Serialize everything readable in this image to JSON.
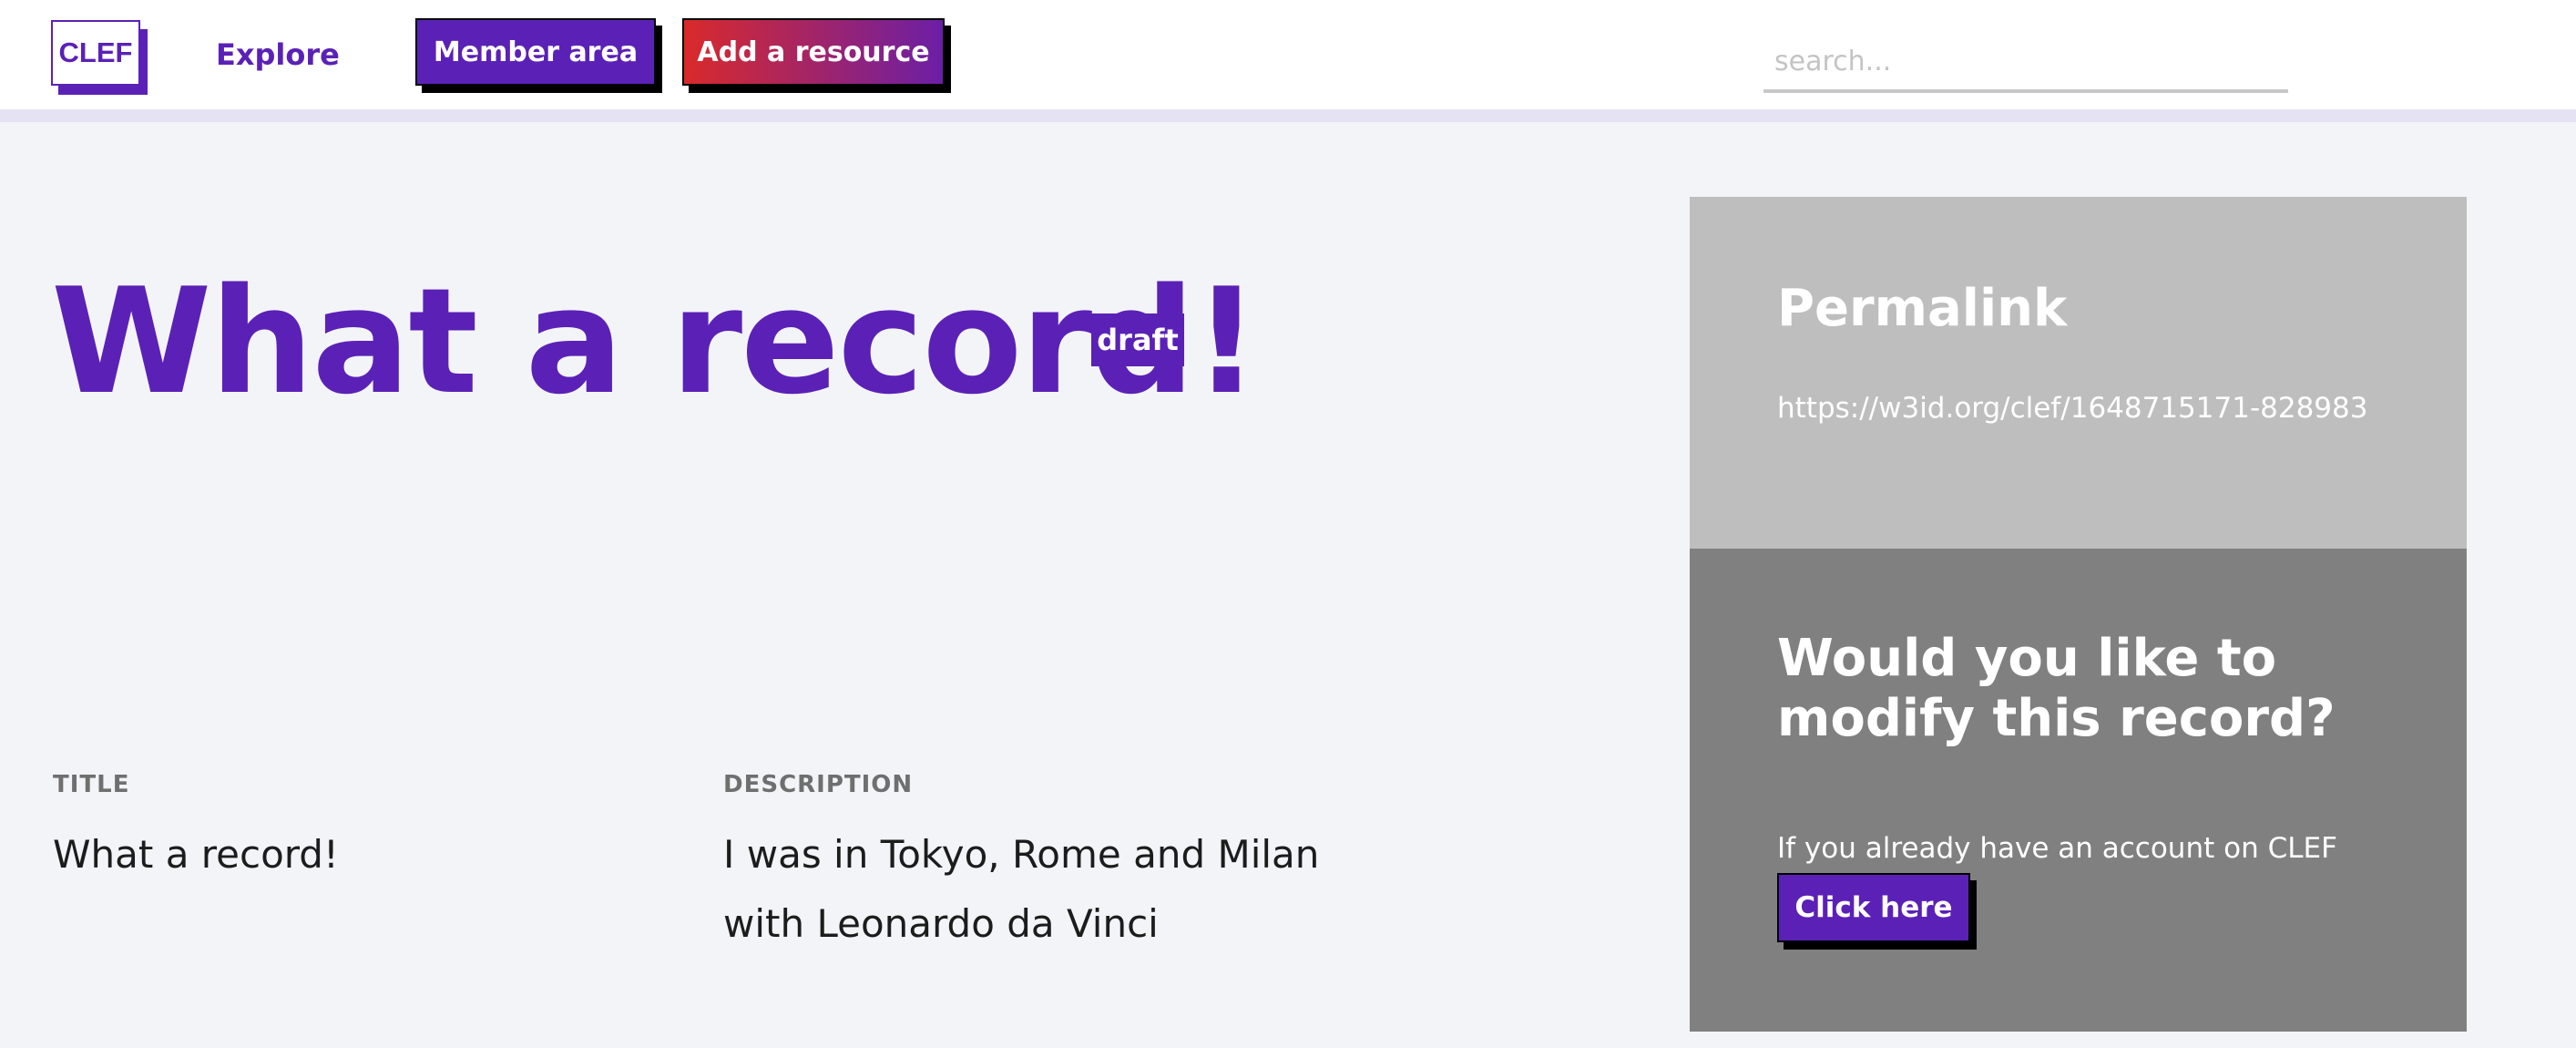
{
  "nav": {
    "logo_text": "CLEF",
    "explore_label": "Explore",
    "member_label": "Member area",
    "add_label": "Add a resource",
    "search_placeholder": "search..."
  },
  "record": {
    "title": "What a record!",
    "status_badge": "draft",
    "fields": {
      "title_label": "TITLE",
      "title_value": "What a record!",
      "description_label": "DESCRIPTION",
      "description_value": "I was in Tokyo, Rome and Milan with Leonardo da Vinci"
    }
  },
  "permalink": {
    "heading": "Permalink",
    "url": "https://w3id.org/clef/1648715171-828983"
  },
  "modify": {
    "heading": "Would you like to modify this record?",
    "text": "If you already have an account on CLEF",
    "button_label": "Click here"
  },
  "colors": {
    "accent": "#5b21b6",
    "page_background": "#f3f4f8",
    "permalink_panel": "#bebebe",
    "modify_panel": "#808080",
    "add_gradient_start": "#d92a2a",
    "add_gradient_end": "#6b1fa6"
  }
}
